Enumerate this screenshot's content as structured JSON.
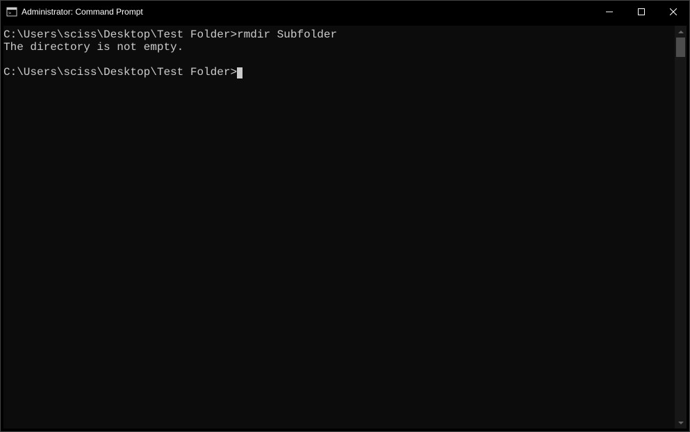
{
  "titlebar": {
    "title": "Administrator: Command Prompt"
  },
  "terminal": {
    "line1_prompt": "C:\\Users\\sciss\\Desktop\\Test Folder>",
    "line1_cmd": "rmdir Subfolder",
    "line2": "The directory is not empty.",
    "line3": "",
    "line4_prompt": "C:\\Users\\sciss\\Desktop\\Test Folder>"
  }
}
